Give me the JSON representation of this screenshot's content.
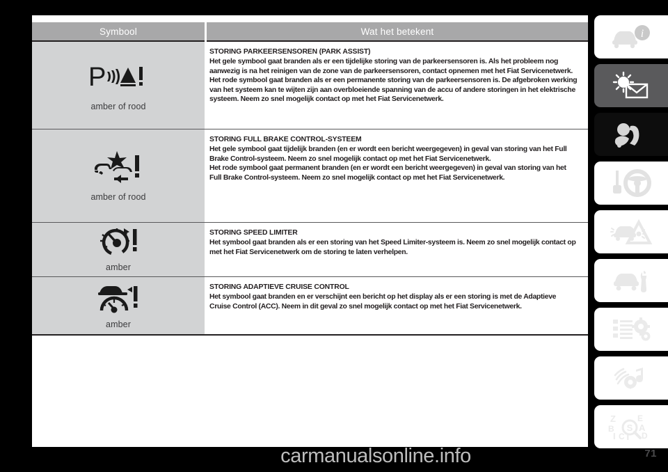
{
  "page": {
    "number": "71",
    "watermark": "carmanualsonline.info"
  },
  "table": {
    "headers": {
      "symbol": "Symbool",
      "meaning": "Wat het betekent"
    },
    "rows": [
      {
        "symbol_icon": "parking-sensor-warning-icon",
        "color_label": "amber of rood",
        "title": "STORING PARKEERSENSOREN (PARK ASSIST)",
        "paragraphs": [
          "Het gele symbool gaat branden als er een tijdelijke storing van de parkeersensoren is. Als het probleem nog aanwezig is na het reinigen van de zone van de parkeersensoren, contact opnemen met het Fiat Servicenetwerk.",
          "Het rode symbool gaat branden als er een permanente storing van de parkeersensoren is. De afgebroken werking van het systeem kan te wijten zijn aan overbloeiende spanning van de accu of andere storingen in het elektrische systeem. Neem zo snel mogelijk contact op met het Fiat Servicenetwerk."
        ]
      },
      {
        "symbol_icon": "full-brake-control-warning-icon",
        "color_label": "amber of rood",
        "title": "STORING FULL BRAKE CONTROL-SYSTEEM",
        "paragraphs": [
          "Het gele symbool gaat tijdelijk branden (en er wordt een bericht weergegeven) in geval van storing van het Full Brake Control-systeem. Neem zo snel mogelijk contact op met het Fiat Servicenetwerk.",
          "Het rode symbool gaat permanent branden (en er wordt een bericht weergegeven) in geval van storing van het Full Brake Control-systeem. Neem zo snel mogelijk contact op met het Fiat Servicenetwerk."
        ]
      },
      {
        "symbol_icon": "speed-limiter-warning-icon",
        "color_label": "amber",
        "title": "STORING SPEED LIMITER",
        "paragraphs": [
          "Het symbool gaat branden als er een storing van het Speed Limiter-systeem is. Neem zo snel mogelijk contact op met het Fiat Servicenetwerk om de storing te laten verhelpen."
        ]
      },
      {
        "symbol_icon": "adaptive-cruise-control-warning-icon",
        "color_label": "amber",
        "title": "STORING ADAPTIEVE CRUISE CONTROL",
        "paragraphs": [
          "Het symbool gaat branden en er verschijnt een bericht op het display als er een storing is met de Adaptieve Cruise Control (ACC). Neem in dit geval zo snel mogelijk contact op met het Fiat Servicenetwerk."
        ]
      }
    ]
  },
  "sidebar": {
    "tabs": [
      {
        "name": "car-info-tab",
        "icon": "car-info-icon",
        "bg": "#ffffff",
        "fg": "#e0e0e0"
      },
      {
        "name": "dashboard-tab",
        "icon": "sun-envelope-icon",
        "bg": "#5a5a5c",
        "fg": "#ffffff"
      },
      {
        "name": "safety-tab",
        "icon": "airbag-child-icon",
        "bg": "#0d0d0d",
        "fg": "#d6d6d6"
      },
      {
        "name": "starting-tab",
        "icon": "key-steering-icon",
        "bg": "#ffffff",
        "fg": "#e0e0e0"
      },
      {
        "name": "emergency-tab",
        "icon": "car-hazard-icon",
        "bg": "#ffffff",
        "fg": "#e8e8e8"
      },
      {
        "name": "maintenance-tab",
        "icon": "car-wrench-icon",
        "bg": "#ffffff",
        "fg": "#e8e8e8"
      },
      {
        "name": "specs-tab",
        "icon": "list-gear-icon",
        "bg": "#ffffff",
        "fg": "#ebebeb"
      },
      {
        "name": "multimedia-tab",
        "icon": "audio-note-icon",
        "bg": "#ffffff",
        "fg": "#ebebeb"
      },
      {
        "name": "index-tab",
        "icon": "alphabetical-index-icon",
        "bg": "#ffffff",
        "fg": "#ebebeb"
      }
    ]
  },
  "colors": {
    "header_bg": "#a8a8a9",
    "symbol_cell_bg": "#d2d3d4",
    "text": "#231f20",
    "page_bg": "#000000"
  }
}
